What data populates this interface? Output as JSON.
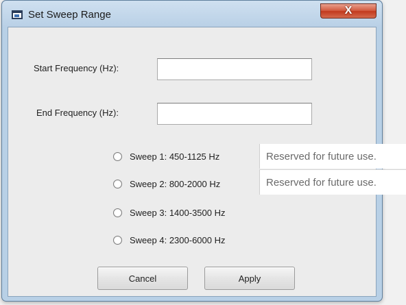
{
  "dialog": {
    "title": "Set Sweep Range",
    "close_label": "X"
  },
  "fields": {
    "start_label": "Start Frequency (Hz):",
    "start_value": "",
    "end_label": "End Frequency (Hz):",
    "end_value": ""
  },
  "sweeps": [
    {
      "label": "Sweep 1: 450-1125 Hz"
    },
    {
      "label": "Sweep 2: 800-2000 Hz"
    },
    {
      "label": "Sweep 3: 1400-3500 Hz"
    },
    {
      "label": "Sweep 4: 2300-6000 Hz"
    }
  ],
  "buttons": {
    "cancel_label": "Cancel",
    "apply_label": "Apply"
  },
  "callouts": [
    {
      "text": "Reserved for future use."
    },
    {
      "text": "Reserved for future use."
    }
  ],
  "colors": {
    "title_bar": "#b9d0e6",
    "close_button": "#c2391d",
    "client_background": "#ececec"
  }
}
